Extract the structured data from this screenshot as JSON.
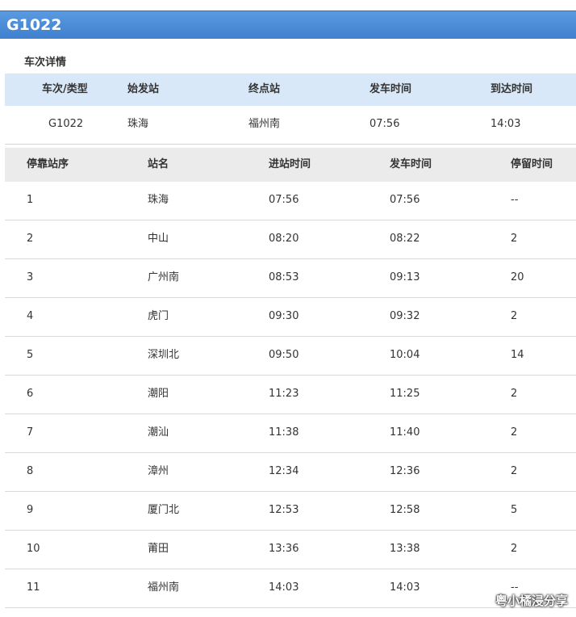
{
  "title": "G1022",
  "section_title": "车次详情",
  "summary": {
    "headers": [
      "车次/类型",
      "始发站",
      "终点站",
      "发车时间",
      "到达时间"
    ],
    "values": [
      "G1022",
      "珠海",
      "福州南",
      "07:56",
      "14:03"
    ]
  },
  "stops": {
    "headers": [
      "停靠站序",
      "站名",
      "进站时间",
      "发车时间",
      "停留时间"
    ],
    "rows": [
      [
        "1",
        "珠海",
        "07:56",
        "07:56",
        "--"
      ],
      [
        "2",
        "中山",
        "08:20",
        "08:22",
        "2"
      ],
      [
        "3",
        "广州南",
        "08:53",
        "09:13",
        "20"
      ],
      [
        "4",
        "虎门",
        "09:30",
        "09:32",
        "2"
      ],
      [
        "5",
        "深圳北",
        "09:50",
        "10:04",
        "14"
      ],
      [
        "6",
        "潮阳",
        "11:23",
        "11:25",
        "2"
      ],
      [
        "7",
        "潮汕",
        "11:38",
        "11:40",
        "2"
      ],
      [
        "8",
        "漳州",
        "12:34",
        "12:36",
        "2"
      ],
      [
        "9",
        "厦门北",
        "12:53",
        "12:58",
        "5"
      ],
      [
        "10",
        "莆田",
        "13:36",
        "13:38",
        "2"
      ],
      [
        "11",
        "福州南",
        "14:03",
        "14:03",
        "--"
      ]
    ]
  },
  "watermark": "粤小橘浸分享",
  "colors": {
    "title_bar": "#3f80cf",
    "summary_header_bg": "#d8e8f8",
    "stops_header_bg": "#ebebeb"
  }
}
